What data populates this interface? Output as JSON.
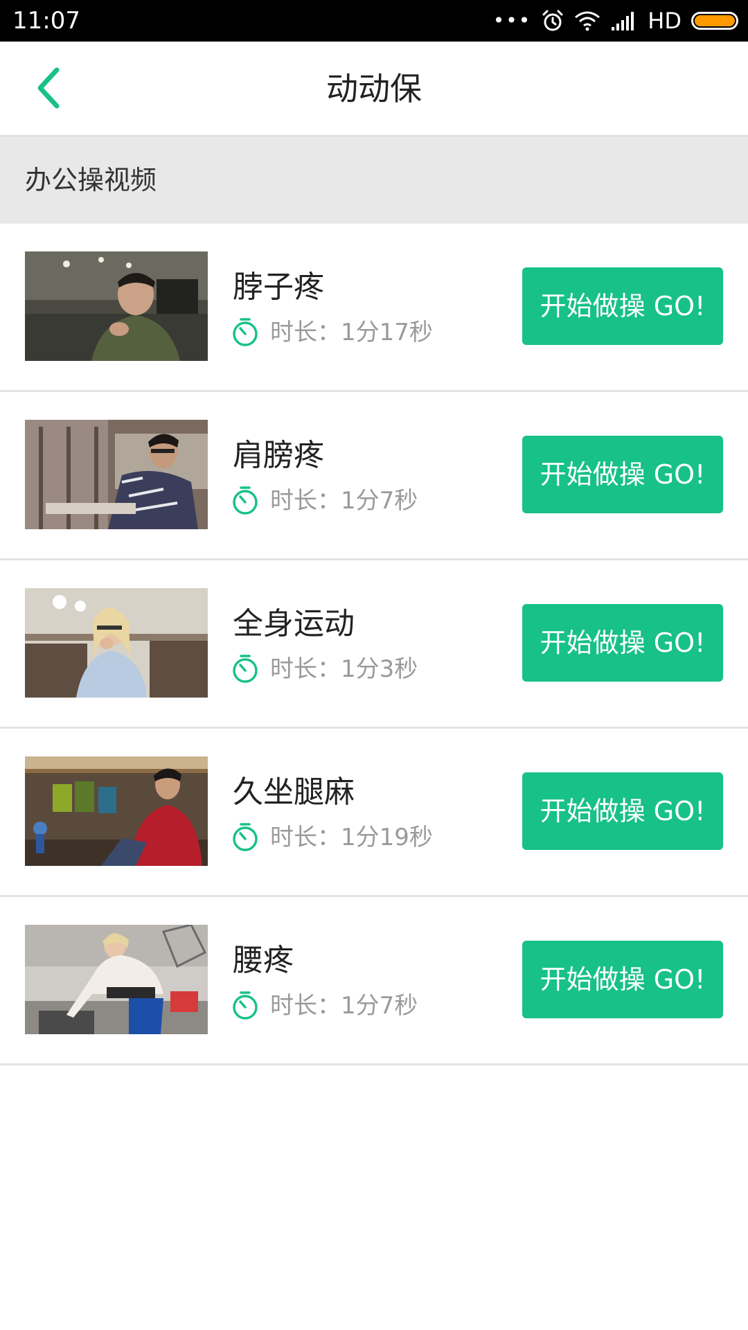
{
  "status_bar": {
    "time": "11:07",
    "dots": "•••",
    "network": "HD",
    "battery_color": "#ff9900"
  },
  "app_bar": {
    "title": "动动保",
    "back_icon": "chevron-left-icon",
    "accent_color": "#17c187"
  },
  "section": {
    "title": "办公操视频"
  },
  "items": [
    {
      "title": "脖子疼",
      "duration": "时长：1分17秒",
      "button": "开始做操 GO!"
    },
    {
      "title": "肩膀疼",
      "duration": "时长：1分7秒",
      "button": "开始做操 GO!"
    },
    {
      "title": "全身运动",
      "duration": "时长：1分3秒",
      "button": "开始做操 GO!"
    },
    {
      "title": "久坐腿麻",
      "duration": "时长：1分19秒",
      "button": "开始做操 GO!"
    },
    {
      "title": "腰疼",
      "duration": "时长：1分7秒",
      "button": "开始做操 GO!"
    }
  ]
}
